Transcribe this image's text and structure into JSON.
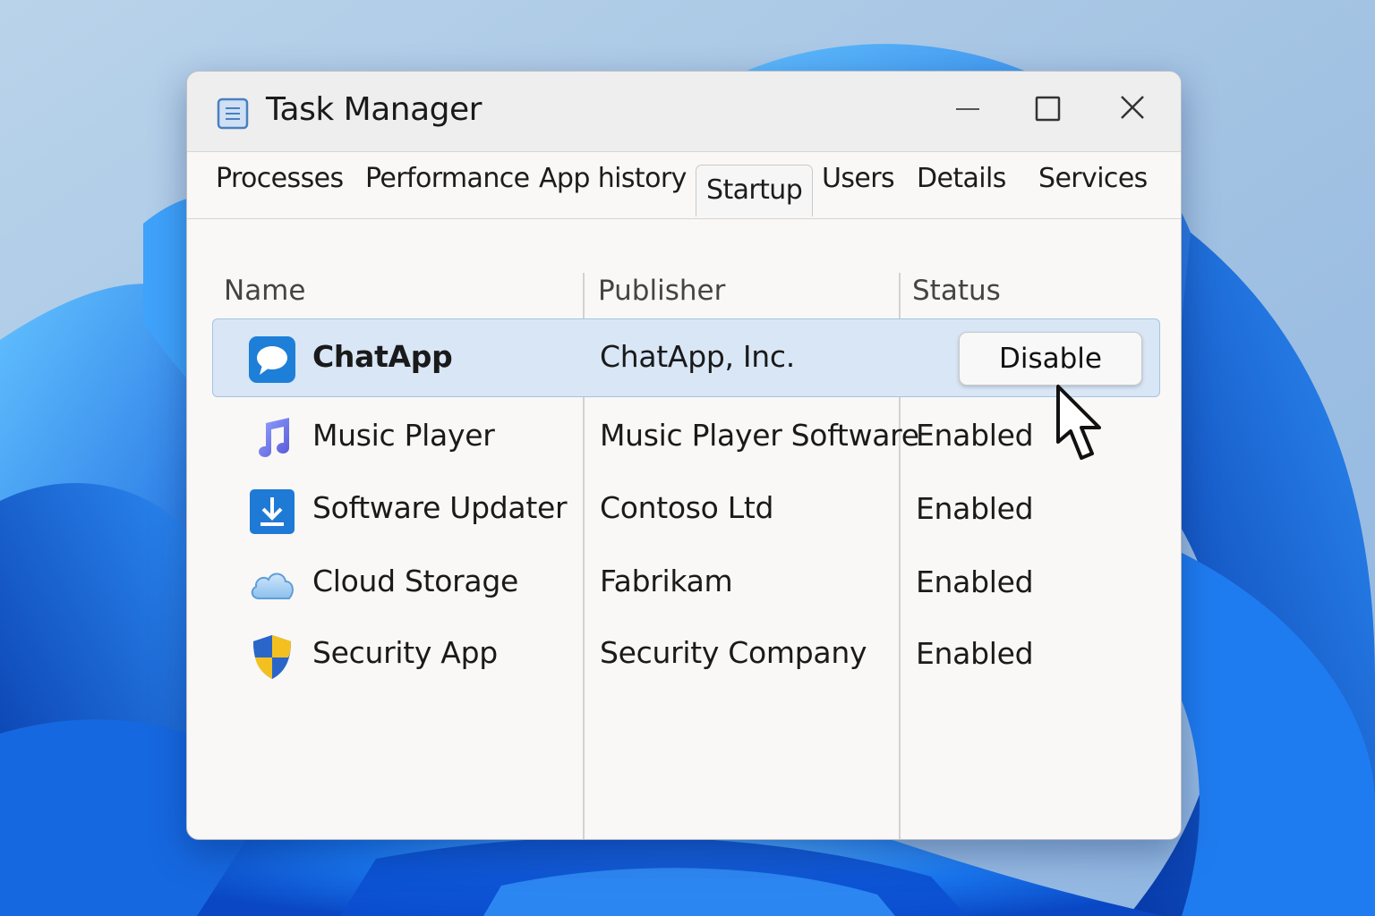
{
  "window": {
    "title": "Task Manager"
  },
  "tabs": [
    {
      "label": "Processes",
      "active": false
    },
    {
      "label": "Performance",
      "active": false
    },
    {
      "label": "App history",
      "active": false
    },
    {
      "label": "Startup",
      "active": true
    },
    {
      "label": "Users",
      "active": false
    },
    {
      "label": "Details",
      "active": false
    },
    {
      "label": "Services",
      "active": false
    }
  ],
  "table": {
    "headers": {
      "name": "Name",
      "publisher": "Publisher",
      "status": "Status"
    },
    "rows": [
      {
        "name": "ChatApp",
        "publisher": "ChatApp, Inc.",
        "status": "",
        "icon": "chat-bubble-icon",
        "selected": true
      },
      {
        "name": "Music Player",
        "publisher": "Music Player Software",
        "status": "Enabled",
        "icon": "music-note-icon",
        "selected": false
      },
      {
        "name": "Software Updater",
        "publisher": "Contoso Ltd",
        "status": "Enabled",
        "icon": "download-icon",
        "selected": false
      },
      {
        "name": "Cloud Storage",
        "publisher": "Fabrikam",
        "status": "Enabled",
        "icon": "cloud-icon",
        "selected": false
      },
      {
        "name": "Security App",
        "publisher": "Security Company",
        "status": "Enabled",
        "icon": "shield-icon",
        "selected": false
      }
    ]
  },
  "actions": {
    "disable_label": "Disable"
  },
  "colors": {
    "accent": "#1e7fd8",
    "selection": "#d8e6f6",
    "wallpaper": "#1f6fe8"
  }
}
